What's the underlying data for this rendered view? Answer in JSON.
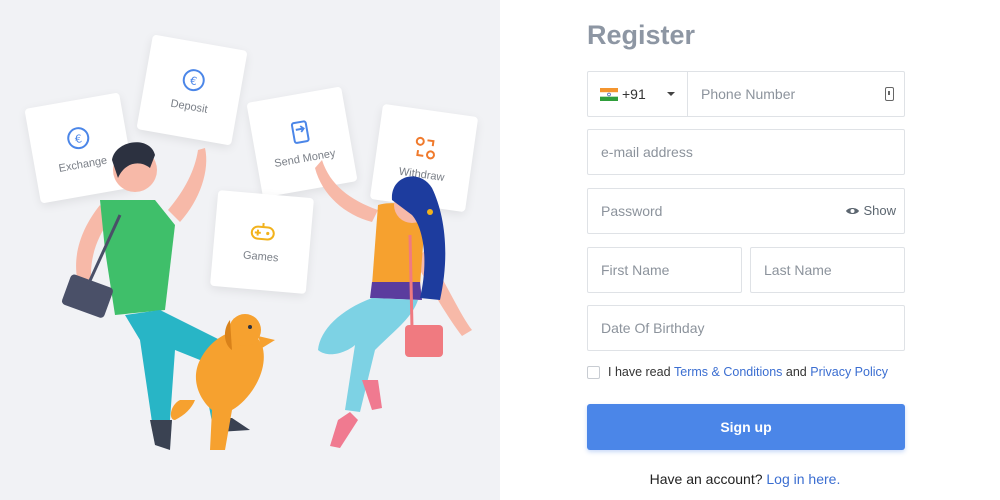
{
  "illustration": {
    "cards": {
      "exchange": "Exchange",
      "deposit": "Deposit",
      "send_money": "Send Money",
      "withdraw": "Withdraw",
      "games": "Games"
    }
  },
  "form": {
    "title": "Register",
    "country_code": "+91",
    "phone_placeholder": "Phone Number",
    "email_placeholder": "e-mail address",
    "password_placeholder": "Password",
    "show_label": "Show",
    "first_name_placeholder": "First Name",
    "last_name_placeholder": "Last Name",
    "birthday_placeholder": "Date Of Birthday",
    "consent": {
      "prefix": "I have read",
      "terms": "Terms & Conditions",
      "and": "and",
      "privacy": "Privacy Policy"
    },
    "submit_label": "Sign up",
    "login_prompt": "Have an account?",
    "login_link": "Log in here."
  },
  "colors": {
    "primary": "#4b86e8",
    "link": "#3b6ed1",
    "left_panel_bg": "#f1f2f5"
  }
}
